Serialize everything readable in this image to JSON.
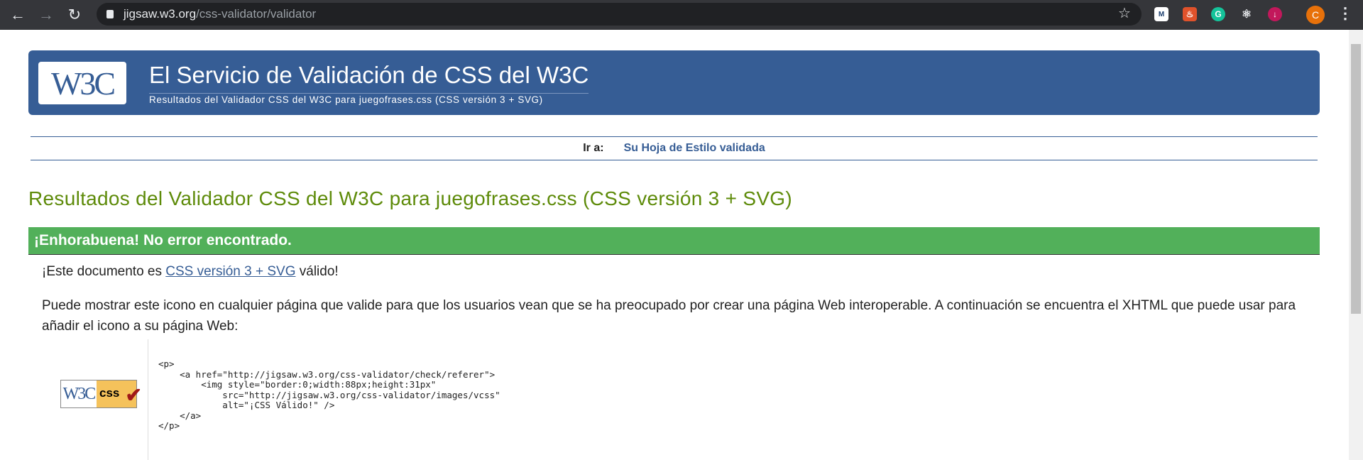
{
  "browser": {
    "url_host": "jigsaw.w3.org",
    "url_path": "/css-validator/validator",
    "avatar_letter": "C",
    "extensions": [
      {
        "icon": "m-plus-icon",
        "color": "#ffffff"
      },
      {
        "icon": "flame-icon",
        "color": "#e0522b"
      },
      {
        "icon": "grammarly-icon",
        "color": "#15c39a"
      },
      {
        "icon": "react-icon",
        "color": "#35363a"
      },
      {
        "icon": "download-icon",
        "color": "#c2185b"
      }
    ]
  },
  "header": {
    "logo": "W3C",
    "title": "El Servicio de Validación de CSS del W3C",
    "subtitle": "Resultados del Validador CSS del W3C para juegofrases.css (CSS versión 3 + SVG)"
  },
  "nav": {
    "label": "Ir a:",
    "link": "Su Hoja de Estilo validada"
  },
  "results": {
    "heading": "Resultados del Validador CSS del W3C para juegofrases.css (CSS versión 3 + SVG)",
    "success": "¡Enhorabuena! No error encontrado.",
    "valid_prefix": "¡Este documento es ",
    "valid_link": "CSS versión 3 + SVG",
    "valid_suffix": " válido!",
    "icon_text": "Puede mostrar este icono en cualquier página que valide para que los usuarios vean que se ha preocupado por crear una página Web interoperable. A continuación se encuentra el XHTML que puede usar para añadir el icono a su página Web:",
    "badge_w3c": "W3C",
    "badge_css": "css",
    "code": "<p>\n    <a href=\"http://jigsaw.w3.org/css-validator/check/referer\">\n        <img style=\"border:0;width:88px;height:31px\"\n            src=\"http://jigsaw.w3.org/css-validator/images/vcss\"\n            alt=\"¡CSS Válido!\" />\n    </a>\n</p>"
  },
  "colors": {
    "banner": "#365d95",
    "success": "#52b05a",
    "heading": "#5e8b0a"
  }
}
